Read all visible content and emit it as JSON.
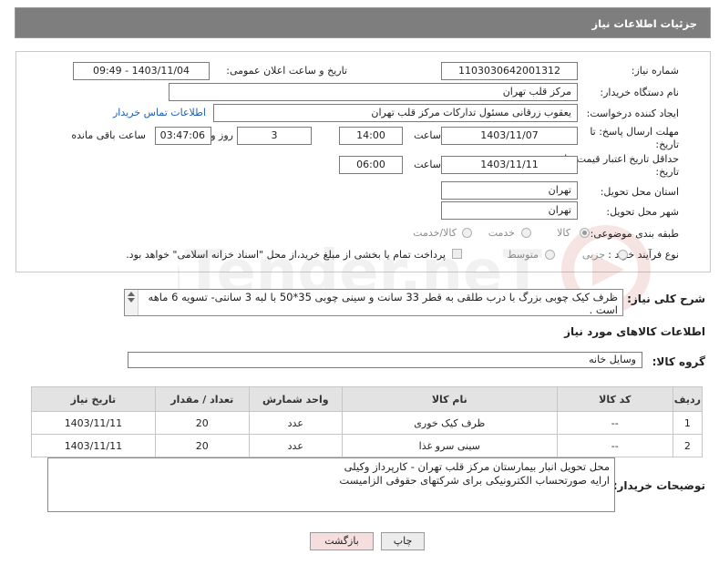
{
  "header": {
    "title": "جزئیات اطلاعات نیاز"
  },
  "form": {
    "need_number_label": "شماره نیاز:",
    "need_number": "1103030642001312",
    "announce_label": "تاریخ و ساعت اعلان عمومی:",
    "announce_value": "1403/11/04 - 09:49",
    "buyer_label": "نام دستگاه خریدار:",
    "buyer_value": "مرکز قلب تهران",
    "creator_label": "ایجاد کننده درخواست:",
    "creator_value": "یعقوب زرقانی مسئول تدارکات مرکز قلب تهران",
    "contact_link": "اطلاعات تماس خریدار",
    "deadline_label_1": "مهلت ارسال پاسخ: تا",
    "deadline_label_2": "تاریخ:",
    "deadline_date": "1403/11/07",
    "time_label": "ساعت",
    "deadline_time": "14:00",
    "days_value": "3",
    "days_label": "روز و",
    "remaining_time": "03:47:06",
    "remaining_label": "ساعت باقی مانده",
    "price_label_1": "حداقل تاریخ اعتبار قیمت: تا",
    "price_label_2": "تاریخ:",
    "price_date": "1403/11/11",
    "price_time_label": "ساعت",
    "price_time": "06:00",
    "province_label": "استان محل تحویل:",
    "province_value": "تهران",
    "city_label": "شهر محل تحویل:",
    "city_value": "تهران",
    "category_label": "طبقه بندی موضوعی:",
    "category_options": [
      "کالا",
      "خدمت",
      "کالا/خدمت"
    ],
    "category_selected": "کالا",
    "process_label": "نوع فرآیند خرید :",
    "process_options": [
      "جزیی",
      "متوسط"
    ],
    "payment_note": "پرداخت تمام یا بخشی از مبلغ خرید،از محل \"اسناد خزانه اسلامی\" خواهد بود."
  },
  "description": {
    "label": "شرح کلی نیاز:",
    "text": "ظرف کیک چوبی بزرگ با درب طلقی به قطر 33 سانت و سینی چوبی 35*50 با لبه 3 سانتی- تسویه 6 ماهه است ."
  },
  "goods": {
    "section_title": "اطلاعات کالاهای مورد نیاز",
    "group_label": "گروه کالا:",
    "group_value": "وسایل خانه",
    "columns": [
      "ردیف",
      "کد کالا",
      "نام کالا",
      "واحد شمارش",
      "تعداد / مقدار",
      "تاریخ نیاز"
    ],
    "rows": [
      {
        "idx": "1",
        "code": "--",
        "name": "ظرف کیک خوری",
        "unit": "عدد",
        "qty": "20",
        "date": "1403/11/11"
      },
      {
        "idx": "2",
        "code": "--",
        "name": "سینی سرو غذا",
        "unit": "عدد",
        "qty": "20",
        "date": "1403/11/11"
      }
    ]
  },
  "buyer_notes": {
    "label": "توضیحات خریدار:",
    "line1": "محل تحویل انبار بیمارستان مرکز قلب تهران - کارپرداز وکیلی",
    "line2": "ارایه صورتحساب الکترونیکی برای شرکتهای حقوقی الزامیست"
  },
  "buttons": {
    "print": "چاپ",
    "back": "بازگشت"
  },
  "watermark": {
    "text": "AriaTender.neT"
  },
  "colors": {
    "header_bg": "#7e7e7e",
    "link": "#1a5fb4",
    "back_button_bg": "#f6dede"
  }
}
